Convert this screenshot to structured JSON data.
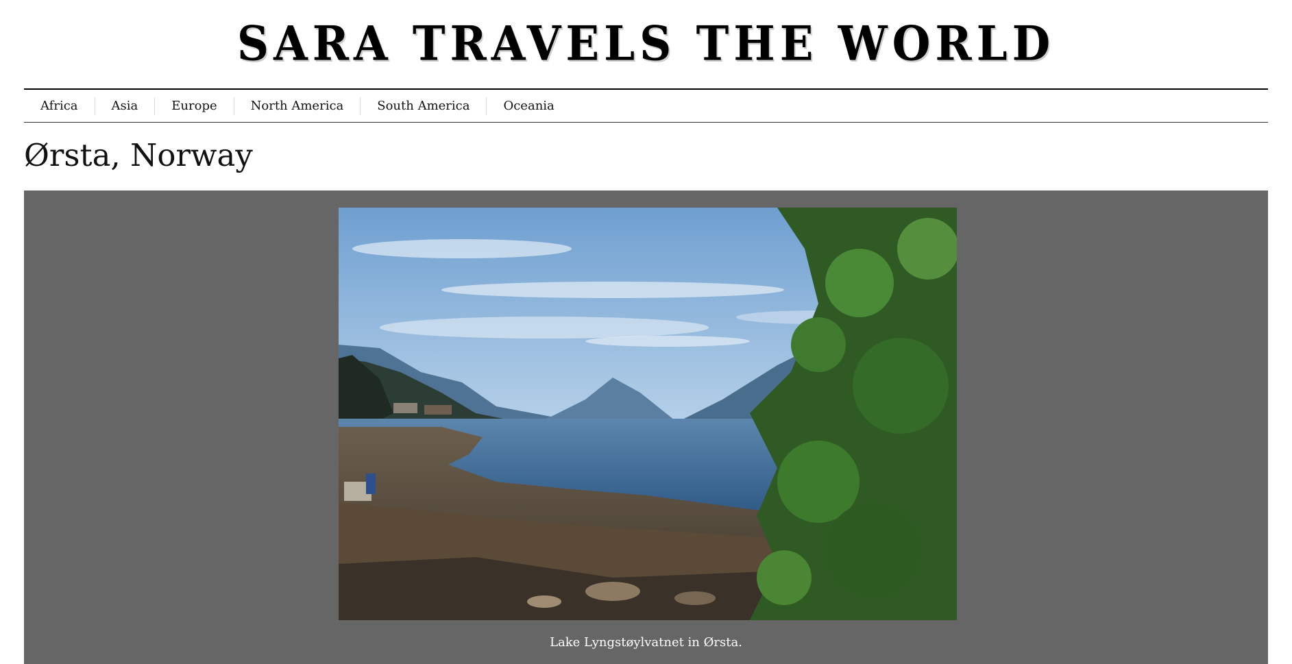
{
  "site": {
    "title": "SARA TRAVELS THE WORLD"
  },
  "nav": {
    "items": [
      {
        "label": "Africa"
      },
      {
        "label": "Asia"
      },
      {
        "label": "Europe"
      },
      {
        "label": "North America"
      },
      {
        "label": "South America"
      },
      {
        "label": "Oceania"
      }
    ]
  },
  "post": {
    "title": "Ørsta, Norway"
  },
  "gallery": {
    "background_color": "#666666",
    "photo": {
      "caption": "Lake Lyngstøylvatnet in Ørsta."
    }
  }
}
